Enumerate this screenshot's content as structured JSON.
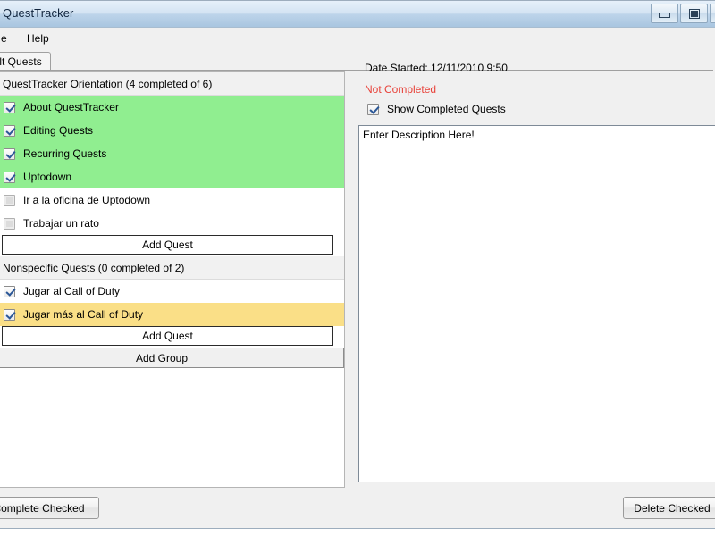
{
  "window": {
    "title": "QuestTracker",
    "buttons": {
      "minimize": "minimize",
      "maximize": "maximize",
      "close": "close"
    }
  },
  "menu": {
    "items": [
      {
        "label": "e",
        "name": "menu-file"
      },
      {
        "label": "Help",
        "name": "menu-help"
      }
    ]
  },
  "tabs": [
    {
      "label": "ault Quests",
      "selected": true
    }
  ],
  "quest_list": {
    "groups": [
      {
        "header": "QuestTracker Orientation (4 completed of 6)",
        "checked": true,
        "quests": [
          {
            "label": "About QuestTracker",
            "checked": true,
            "state": "done"
          },
          {
            "label": "Editing Quests",
            "checked": true,
            "state": "done"
          },
          {
            "label": "Recurring Quests",
            "checked": true,
            "state": "done"
          },
          {
            "label": "Uptodown",
            "checked": true,
            "state": "done"
          },
          {
            "label": "Ir a la oficina de Uptodown",
            "checked": false,
            "state": "undone"
          },
          {
            "label": "Trabajar un rato",
            "checked": false,
            "state": "undone"
          }
        ],
        "add_quest_label": "Add Quest"
      },
      {
        "header": "Nonspecific Quests (0 completed of 2)",
        "checked": true,
        "quests": [
          {
            "label": "Jugar al Call of Duty",
            "checked": true,
            "state": "undone"
          },
          {
            "label": "Jugar más al Call of Duty",
            "checked": true,
            "state": "warn"
          }
        ],
        "add_quest_label": "Add Quest"
      }
    ],
    "add_group_label": "Add Group"
  },
  "details": {
    "date_started": "Date Started: 12/11/2010 9:50",
    "status": "Not Completed",
    "show_completed_label": "Show Completed Quests",
    "show_completed_checked": true,
    "description": "Enter Description Here!"
  },
  "footer": {
    "complete_checked_label": "Complete Checked",
    "delete_checked_label": "Delete Checked"
  },
  "colors": {
    "completed_row": "#90ee90",
    "warning_row": "#fadf87",
    "status_red": "#e8423a",
    "group_header": "#f1f1f1"
  }
}
